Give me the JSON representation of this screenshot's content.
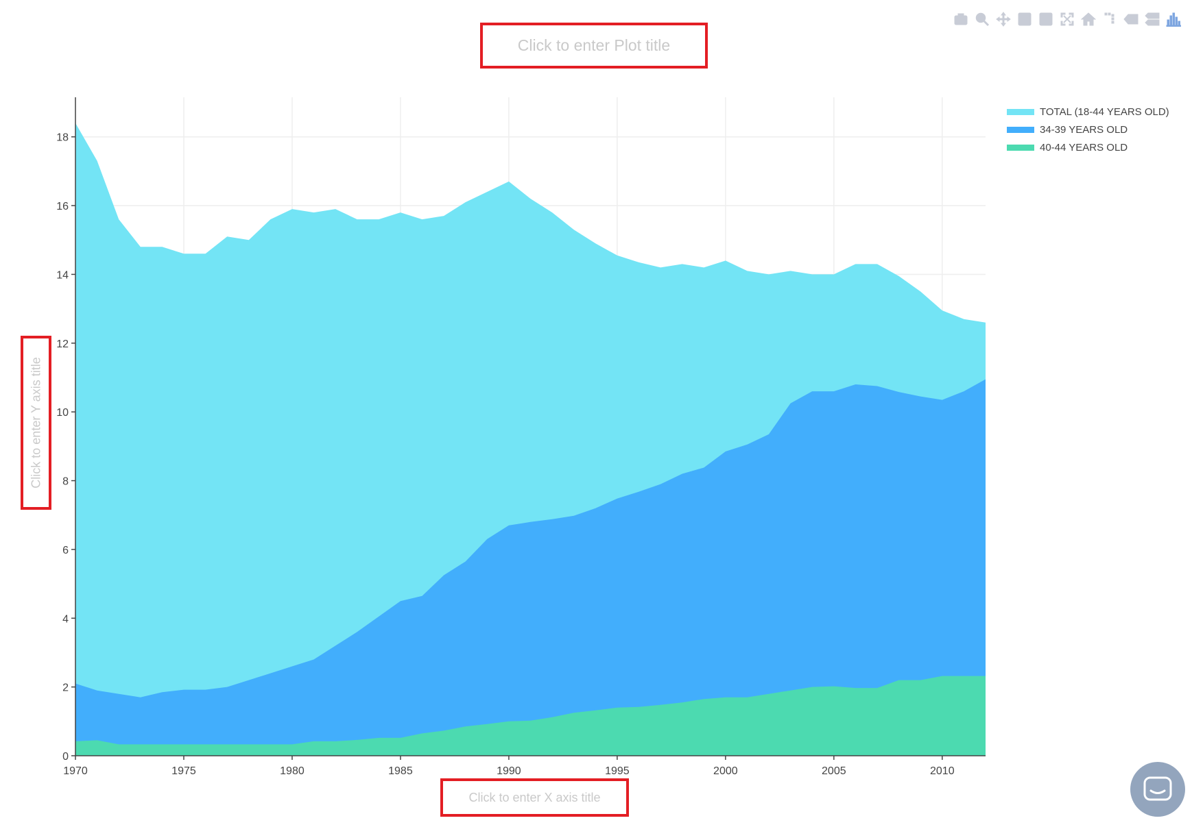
{
  "toolbar": {
    "buttons": [
      {
        "name": "camera-icon",
        "title": "Download plot as a png"
      },
      {
        "name": "zoom-icon",
        "title": "Zoom"
      },
      {
        "name": "pan-icon",
        "title": "Pan"
      },
      {
        "name": "zoom-in-icon",
        "title": "Zoom in"
      },
      {
        "name": "zoom-out-icon",
        "title": "Zoom out"
      },
      {
        "name": "autoscale-icon",
        "title": "Autoscale"
      },
      {
        "name": "home-icon",
        "title": "Reset axes"
      },
      {
        "name": "spikelines-icon",
        "title": "Toggle Spike Lines"
      },
      {
        "name": "hover-closest-icon",
        "title": "Show closest data on hover"
      },
      {
        "name": "hover-compare-icon",
        "title": "Compare data on hover"
      },
      {
        "name": "plotly-logo-icon",
        "title": "Produced with Plotly"
      }
    ]
  },
  "placeholders": {
    "plot_title": "Click to enter Plot title",
    "x_axis_title": "Click to enter X axis title",
    "y_axis_title": "Click to enter Y axis title"
  },
  "colors": {
    "total": "#73e4f5",
    "age_34_39": "#42aefc",
    "age_40_44": "#4cdab0",
    "grid": "#eeeeee",
    "annotation_box": "#e31e24"
  },
  "chart_data": {
    "type": "area",
    "title": "",
    "xlabel": "",
    "ylabel": "",
    "xlim": [
      1970,
      2012
    ],
    "ylim": [
      0,
      18
    ],
    "x_ticks": [
      1970,
      1975,
      1980,
      1985,
      1990,
      1995,
      2000,
      2005,
      2010
    ],
    "y_ticks": [
      0,
      2,
      4,
      6,
      8,
      10,
      12,
      14,
      16,
      18
    ],
    "grid": true,
    "legend_position": "top-right",
    "x": [
      1970,
      1971,
      1972,
      1973,
      1974,
      1975,
      1976,
      1977,
      1978,
      1979,
      1980,
      1981,
      1982,
      1983,
      1984,
      1985,
      1986,
      1987,
      1988,
      1989,
      1990,
      1991,
      1992,
      1993,
      1994,
      1995,
      1996,
      1997,
      1998,
      1999,
      2000,
      2001,
      2002,
      2003,
      2004,
      2005,
      2006,
      2007,
      2008,
      2009,
      2010,
      2011,
      2012
    ],
    "series": [
      {
        "name": "TOTAL (18-44 YEARS OLD)",
        "values": [
          18.4,
          17.3,
          15.6,
          14.8,
          14.8,
          14.6,
          14.6,
          15.1,
          15.0,
          15.6,
          15.9,
          15.8,
          15.9,
          15.6,
          15.6,
          15.8,
          15.6,
          15.7,
          16.1,
          16.4,
          16.7,
          16.2,
          15.8,
          15.3,
          14.9,
          14.55,
          14.35,
          14.2,
          14.3,
          14.2,
          14.4,
          14.1,
          14.0,
          14.1,
          14.0,
          14.0,
          14.3,
          14.3,
          13.95,
          13.5,
          12.95,
          12.7,
          12.6
        ]
      },
      {
        "name": "34-39 YEARS OLD",
        "values": [
          2.1,
          1.9,
          1.8,
          1.7,
          1.85,
          1.92,
          1.92,
          2.0,
          2.2,
          2.4,
          2.6,
          2.8,
          3.2,
          3.6,
          4.05,
          4.5,
          4.65,
          5.25,
          5.65,
          6.3,
          6.7,
          6.8,
          6.88,
          6.98,
          7.2,
          7.48,
          7.68,
          7.9,
          8.2,
          8.38,
          8.85,
          9.05,
          9.35,
          10.25,
          10.6,
          10.6,
          10.8,
          10.75,
          10.58,
          10.45,
          10.35,
          10.6,
          10.95
        ]
      },
      {
        "name": "40-44 YEARS OLD",
        "values": [
          0.42,
          0.45,
          0.33,
          0.33,
          0.33,
          0.33,
          0.33,
          0.33,
          0.33,
          0.33,
          0.33,
          0.42,
          0.42,
          0.46,
          0.52,
          0.52,
          0.65,
          0.73,
          0.85,
          0.92,
          1.0,
          1.02,
          1.12,
          1.25,
          1.32,
          1.4,
          1.42,
          1.48,
          1.55,
          1.65,
          1.7,
          1.7,
          1.8,
          1.9,
          2.0,
          2.02,
          1.97,
          1.97,
          2.2,
          2.2,
          2.32,
          2.32,
          2.32
        ]
      }
    ]
  },
  "chat": {
    "icon": "chat-icon"
  }
}
